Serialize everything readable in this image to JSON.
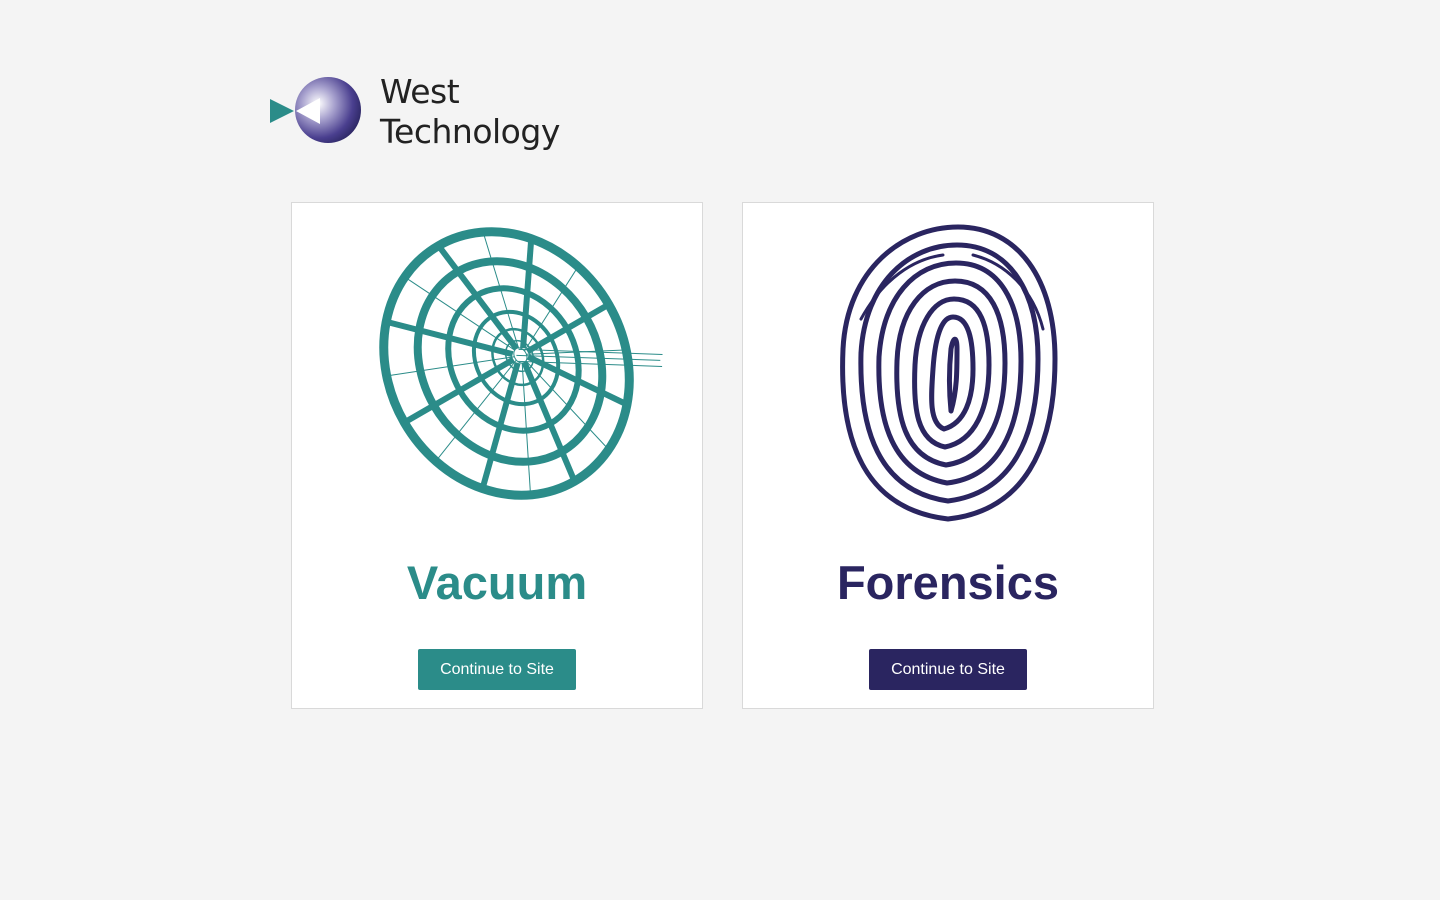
{
  "brand": {
    "line1": "West",
    "line2": "Technology",
    "logo_icon": "west-technology-logo-icon"
  },
  "colors": {
    "background": "#f4f4f4",
    "vacuum_accent": "#2b8c89",
    "forensics_accent": "#2a2560"
  },
  "cards": [
    {
      "title": "Vacuum",
      "icon": "vacuum-funnel-icon",
      "button_label": "Continue to Site",
      "accent": "#2b8c89"
    },
    {
      "title": "Forensics",
      "icon": "fingerprint-icon",
      "button_label": "Continue to Site",
      "accent": "#2a2560"
    }
  ]
}
